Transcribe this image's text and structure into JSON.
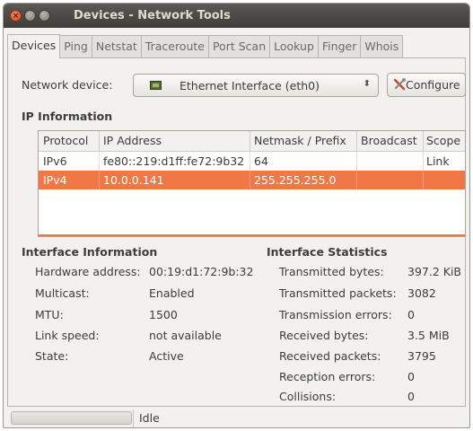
{
  "window": {
    "title": "Devices - Network Tools"
  },
  "tabs": [
    "Devices",
    "Ping",
    "Netstat",
    "Traceroute",
    "Port Scan",
    "Lookup",
    "Finger",
    "Whois"
  ],
  "device": {
    "label": "Network device:",
    "selected": "Ethernet Interface (eth0)",
    "configure_label": "Configure"
  },
  "ip_info": {
    "heading": "IP Information",
    "columns": [
      "Protocol",
      "IP Address",
      "Netmask / Prefix",
      "Broadcast",
      "Scope"
    ],
    "rows": [
      {
        "protocol": "IPv6",
        "address": "fe80::219:d1ff:fe72:9b32",
        "netmask": "64",
        "broadcast": "",
        "scope": "Link"
      },
      {
        "protocol": "IPv4",
        "address": "10.0.0.141",
        "netmask": "255.255.255.0",
        "broadcast": "",
        "scope": ""
      }
    ],
    "selected_row_color": "#f07746"
  },
  "interface_info": {
    "heading": "Interface Information",
    "hardware_label": "Hardware address:",
    "hardware_value": "00:19:d1:72:9b:32",
    "multicast_label": "Multicast:",
    "multicast_value": "Enabled",
    "mtu_label": "MTU:",
    "mtu_value": "1500",
    "link_label": "Link speed:",
    "link_value": "not available",
    "state_label": "State:",
    "state_value": "Active"
  },
  "interface_stats": {
    "heading": "Interface Statistics",
    "tx_bytes_label": "Transmitted bytes:",
    "tx_bytes_value": "397.2 KiB",
    "tx_packets_label": "Transmitted packets:",
    "tx_packets_value": "3082",
    "tx_errors_label": "Transmission errors:",
    "tx_errors_value": "0",
    "rx_bytes_label": "Received bytes:",
    "rx_bytes_value": "3.5 MiB",
    "rx_packets_label": "Received packets:",
    "rx_packets_value": "3795",
    "rx_errors_label": "Reception errors:",
    "rx_errors_value": "0",
    "collisions_label": "Collisions:",
    "collisions_value": "0"
  },
  "statusbar": {
    "text": "Idle"
  },
  "icons": {
    "close": "close-icon",
    "minimize": "minimize-icon",
    "maximize": "maximize-icon",
    "nic": "network-card-icon",
    "configure": "wrench-screwdriver-icon",
    "dropdown": "updown-arrow-icon"
  }
}
